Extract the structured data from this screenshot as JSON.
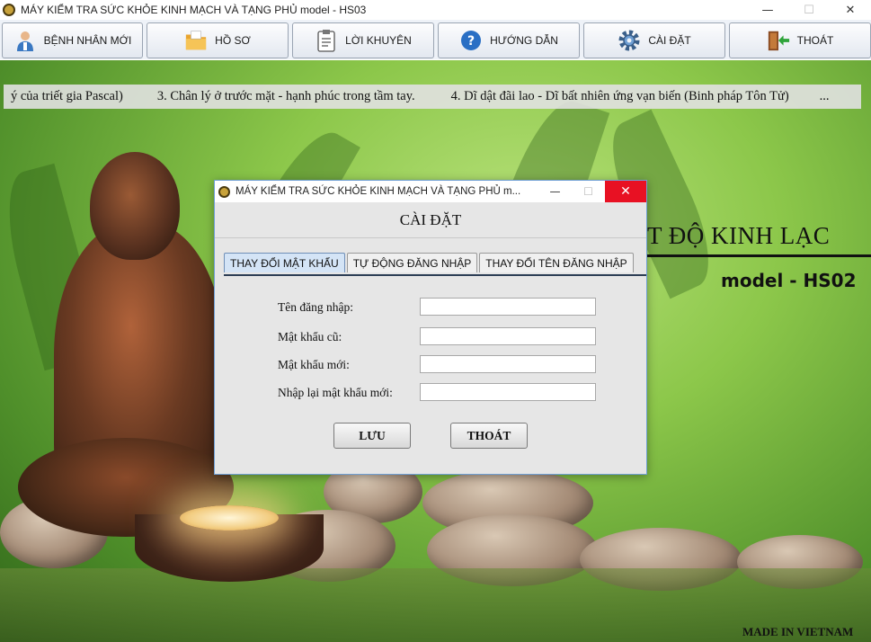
{
  "window": {
    "title": "MÁY KIỂM TRA SỨC KHỎE KINH MẠCH VÀ TẠNG PHỦ   model - HS03",
    "minimize_glyph": "—",
    "maximize_glyph": "☐",
    "close_glyph": "✕"
  },
  "toolbar": {
    "items": [
      {
        "label": "BỆNH NHÂN MỚI",
        "icon": "patient-icon"
      },
      {
        "label": "HỒ SƠ",
        "icon": "folder-icon"
      },
      {
        "label": "LỜI KHUYÊN",
        "icon": "clipboard-icon"
      },
      {
        "label": "HƯỚNG DẪN",
        "icon": "help-icon"
      },
      {
        "label": "CÀI ĐẶT",
        "icon": "gear-icon"
      },
      {
        "label": "THOÁT",
        "icon": "exit-door-icon"
      }
    ]
  },
  "marquee": {
    "items": [
      "ý của triết gia Pascal)",
      "3. Chân lý ở trước mặt - hạnh phúc trong tầm tay.",
      "4. Dĩ dật đãi lao - Dĩ bất nhiên ứng vạn biến (Binh pháp Tôn Tử)",
      "..."
    ]
  },
  "background": {
    "heading_partial": "T ĐỘ KINH LẠC",
    "model": "model - HS02",
    "made_in": "MADE IN VIETNAM"
  },
  "dialog": {
    "title": "MÁY KIỂM TRA SỨC KHỎE KINH MẠCH VÀ TẠNG PHỦ   m...",
    "minimize_glyph": "—",
    "maximize_glyph": "☐",
    "close_glyph": "✕",
    "header": "CÀI ĐẶT",
    "tabs": [
      {
        "label": "THAY ĐỔI MẬT KHẨU",
        "active": true
      },
      {
        "label": "TỰ ĐỘNG ĐĂNG NHẬP",
        "active": false
      },
      {
        "label": "THAY ĐỔI TÊN ĐĂNG NHẬP",
        "active": false
      }
    ],
    "fields": [
      {
        "label": "Tên đăng nhập:",
        "value": ""
      },
      {
        "label": "Mật khẩu cũ:",
        "value": ""
      },
      {
        "label": "Mật khẩu mới:",
        "value": ""
      },
      {
        "label": "Nhập lại mật khẩu mới:",
        "value": ""
      }
    ],
    "save_label": "LƯU",
    "exit_label": "THOÁT"
  },
  "colors": {
    "accent": "#6f9fd4",
    "close_red": "#e81123",
    "active_tab": "#d4e4f6"
  }
}
